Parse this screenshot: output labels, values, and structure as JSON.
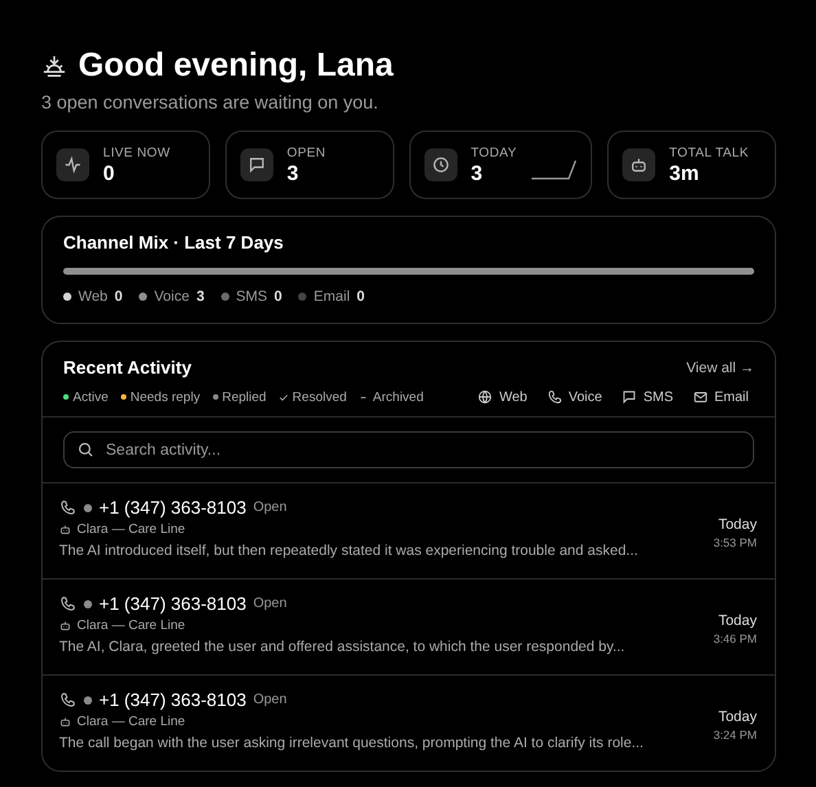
{
  "greeting": {
    "title": "Good evening, Lana",
    "subtitle": "3 open conversations are waiting on you."
  },
  "stats": [
    {
      "kind": "pulse",
      "label": "LIVE NOW",
      "value": "0",
      "sparkline": false
    },
    {
      "kind": "chat",
      "label": "OPEN",
      "value": "3",
      "sparkline": false
    },
    {
      "kind": "clock",
      "label": "TODAY",
      "value": "3",
      "sparkline": true
    },
    {
      "kind": "robot",
      "label": "TOTAL TALK",
      "value": "3m",
      "sparkline": false
    }
  ],
  "channel_mix": {
    "title": "Channel Mix · Last 7 Days",
    "channels": [
      {
        "label": "Web",
        "count": "0",
        "color": "#d4d4d4"
      },
      {
        "label": "Voice",
        "count": "3",
        "color": "#8f8f8f"
      },
      {
        "label": "SMS",
        "count": "0",
        "color": "#6a6a6a"
      },
      {
        "label": "Email",
        "count": "0",
        "color": "#454545"
      }
    ]
  },
  "activity": {
    "title": "Recent Activity",
    "view_all": "View all →",
    "legend": [
      {
        "kind": "dot",
        "label": "Active",
        "color": "#4ade80"
      },
      {
        "kind": "dot",
        "label": "Needs reply",
        "color": "#f5b342"
      },
      {
        "kind": "dot",
        "label": "Replied",
        "color": "#8a8a8a"
      },
      {
        "kind": "check",
        "label": "Resolved"
      },
      {
        "kind": "dash",
        "label": "Archived"
      }
    ],
    "filters": [
      {
        "kind": "globe",
        "label": "Web"
      },
      {
        "kind": "phone",
        "label": "Voice"
      },
      {
        "kind": "chat",
        "label": "SMS"
      },
      {
        "kind": "mail",
        "label": "Email"
      }
    ],
    "search": {
      "placeholder": "Search activity..."
    },
    "rows": [
      {
        "kind": "phone",
        "color": "#8a8a8a",
        "caller": "+1 (347) 363-8103",
        "status": "Open",
        "agent": "Clara — Care Line",
        "summary": "The AI introduced itself, but then repeatedly stated it was experiencing trouble and asked...",
        "day": "Today",
        "time": "3:53 PM"
      },
      {
        "kind": "phone",
        "color": "#8a8a8a",
        "caller": "+1 (347) 363-8103",
        "status": "Open",
        "agent": "Clara — Care Line",
        "summary": "The AI, Clara, greeted the user and offered assistance, to which the user responded by...",
        "day": "Today",
        "time": "3:46 PM"
      },
      {
        "kind": "phone",
        "color": "#8a8a8a",
        "caller": "+1 (347) 363-8103",
        "status": "Open",
        "agent": "Clara — Care Line",
        "summary": "The call began with the user asking irrelevant questions, prompting the AI to clarify its role...",
        "day": "Today",
        "time": "3:24 PM"
      }
    ]
  }
}
